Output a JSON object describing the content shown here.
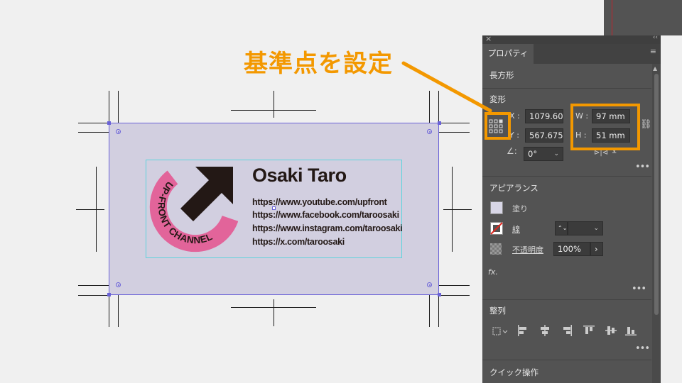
{
  "callout": {
    "label": "基準点を設定",
    "color": "#f39800"
  },
  "card": {
    "name": "Osaki Taro",
    "links": [
      "https://www.youtube.com/upfront",
      "https://www.facebook.com/taroosaki",
      "https://www.instagram.com/taroosaki",
      "https://x.com/taroosaki"
    ],
    "logo_text": "UP-FRONT CHANNEL",
    "background_color": "#d2cfe0",
    "logo_color": "#e2649a"
  },
  "panel": {
    "tab": "プロパティ",
    "object_type": "長方形",
    "transform": {
      "title": "変形",
      "x_label": "X :",
      "x_value": "1079.60",
      "y_label": "Y :",
      "y_value": "567.675",
      "w_label": "W :",
      "w_value": "97 mm",
      "h_label": "H :",
      "h_value": "51 mm",
      "angle_value": "0°"
    },
    "appearance": {
      "title": "アピアランス",
      "fill_label": "塗り",
      "stroke_label": "線",
      "opacity_label": "不透明度",
      "opacity_value": "100%",
      "fx_label": "fx."
    },
    "align": {
      "title": "整列"
    },
    "quick_actions": {
      "title": "クイック操作"
    }
  }
}
